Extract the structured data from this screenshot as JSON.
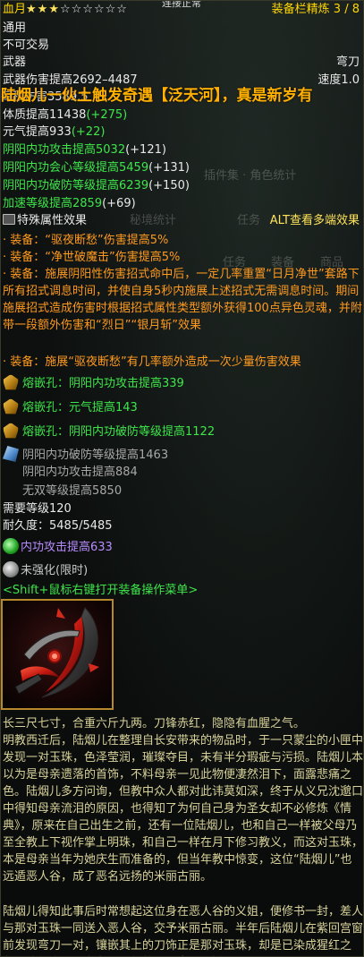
{
  "header": {
    "item_name": "血月",
    "stars_on": "★★★",
    "stars_off": "☆☆☆☆☆☆",
    "connection": "连接正常",
    "refine": "装备栏精炼 3 / 8"
  },
  "basic": {
    "class": "通用",
    "tradable": "不可交易",
    "slot": "武器",
    "weapon_type": "弯刀",
    "damage": "武器伤害提高2692–4487",
    "speed": "速度1.0",
    "dps": "每秒伤害3589.5",
    "banner": "陆烟儿一伙土触发奇遇【泛天河】，真是新岁有",
    "stat1": "体质提高11438",
    "stat1_bonus": "(+275)",
    "stat2": "元气提高933",
    "stat2_bonus": "(+22)"
  },
  "green_stats": [
    {
      "text": "阴阳内功攻击提高5032",
      "bonus": "(+121)"
    },
    {
      "text": "阴阳内功会心等级提高5459",
      "bonus": "(+131)"
    },
    {
      "text": "阴阳内功破防等级提高6239",
      "bonus": "(+150)"
    },
    {
      "text": "加速等级提高2859",
      "bonus": "(+69)"
    }
  ],
  "ghost": {
    "plugin": "插件集 · 角色统计",
    "stats": "秘境统计",
    "task": "任务",
    "task2": "任务",
    "equip": "装备",
    "goods": "商品"
  },
  "special": {
    "title": "特殊属性效果",
    "alt_hint": "ALT查看多端效果",
    "lines": [
      "· 装备：“驱夜断愁”伤害提高5%",
      "· 装备：“净世破魔击”伤害提高5%",
      "· 装备：施展阴阳性伤害招式命中后，一定几率重置“日月净世”套路下所有招式调息时间，并使自身5秒内施展上述招式无需调息时间。期间施展招式造成伤害时根据招式属性类型额外获得100点异色灵魂，并附带一段额外伤害和“烈日”“银月斩”效果",
      "· 装备：施展“驱夜断愁”有几率额外造成一次少量伤害效果"
    ]
  },
  "gems": [
    "熔嵌孔：阴阳内功攻击提高339",
    "熔嵌孔：元气提高143",
    "熔嵌孔：阴阳内功破防等级提高1122"
  ],
  "soul": [
    "阴阳内功破防等级提高1463",
    "阴阳内功攻击提高884",
    "无双等级提高5850"
  ],
  "requirements": {
    "level": "需要等级120",
    "durability": "耐久度：5485/5485"
  },
  "enchant": {
    "attack": "内功攻击提高633",
    "unenhanced": "未强化(限时)",
    "shift_hint": "<Shift+鼠标右键打开装备操作菜单>"
  },
  "description": {
    "p1": "长三尺七寸，合重六斤九两。刀锋赤红，隐隐有血腥之气。",
    "p2": "明教西迁后，陆烟儿在整理自长安带来的物品时，于一只蒙尘的小匣中发现一对玉珠，色泽莹润，璀璨夺目，未有半分瑕疵与污损。陆烟儿本以为是母亲遗落的首饰，不料母亲一见此物便凄然泪下，面露悲痛之色。陆烟儿多方问询，但教中众人都对此讳莫如深，终于从义兄沈邈口中得知母亲流泪的原因，也得知了为何自己身为圣女却不必修炼《情典》，原来在自己出生之前，还有一位陆烟儿，也和自己一样被父母乃至全教上下视作掌上明珠，和自己一样在月下修习教义，而这对玉珠，本是母亲当年为她庆生而准备的，但当年教中惊变，这位“陆烟儿”也远遁恶人谷，成了恶名远扬的米丽古丽。",
    "p3": "陆烟儿得知此事后时常想起这位身在恶人谷的义姐，便修书一封，差人与那对玉珠一同送入恶人谷，交予米丽古丽。半年后陆烟儿在紫回宫窗前发现弯刀一对，镶嵌其上的刀饰正是那对玉珠，却是已染成猩红之色。信纸之上只有龙飞凤舞的两个字：“收好”。"
  },
  "colors": {
    "gold": "#ffd700",
    "green": "#3ee64b",
    "orange": "#ff9a1f",
    "purple": "#b78cff",
    "tan": "#d8d29a",
    "banner": "#ffb000"
  },
  "icons": {
    "section": "monitor-icon",
    "gem": "gem-icon",
    "soul": "soul-stone-icon",
    "enchant": "green-orb-icon",
    "unenhanced": "grey-orb-icon",
    "weapon": "crescent-blade-image"
  }
}
